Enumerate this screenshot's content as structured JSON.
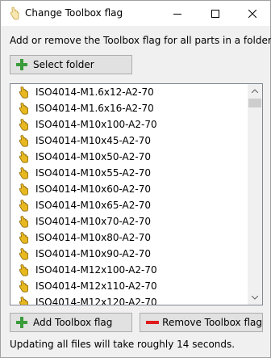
{
  "window": {
    "title": "Change Toolbox flag",
    "controls": [
      "minimize",
      "maximize",
      "close"
    ]
  },
  "instruction": "Add or remove the Toolbox flag for all parts in a folder.",
  "buttons": {
    "select_folder": "Select folder",
    "add_flag": "Add Toolbox flag",
    "remove_flag": "Remove Toolbox flag"
  },
  "parts": [
    "ISO4014-M1.6x12-A2-70",
    "ISO4014-M1.6x16-A2-70",
    "ISO4014-M10x100-A2-70",
    "ISO4014-M10x45-A2-70",
    "ISO4014-M10x50-A2-70",
    "ISO4014-M10x55-A2-70",
    "ISO4014-M10x60-A2-70",
    "ISO4014-M10x65-A2-70",
    "ISO4014-M10x70-A2-70",
    "ISO4014-M10x80-A2-70",
    "ISO4014-M10x90-A2-70",
    "ISO4014-M12x100-A2-70",
    "ISO4014-M12x110-A2-70",
    "ISO4014-M12x120-A2-70"
  ],
  "status": "Updating all files will take roughly 14 seconds.",
  "colors": {
    "add_icon": "#3b9c3b",
    "remove_icon": "#e01b1b",
    "part_icon": "#e8b820",
    "window_bg": "#f0f0f0"
  }
}
